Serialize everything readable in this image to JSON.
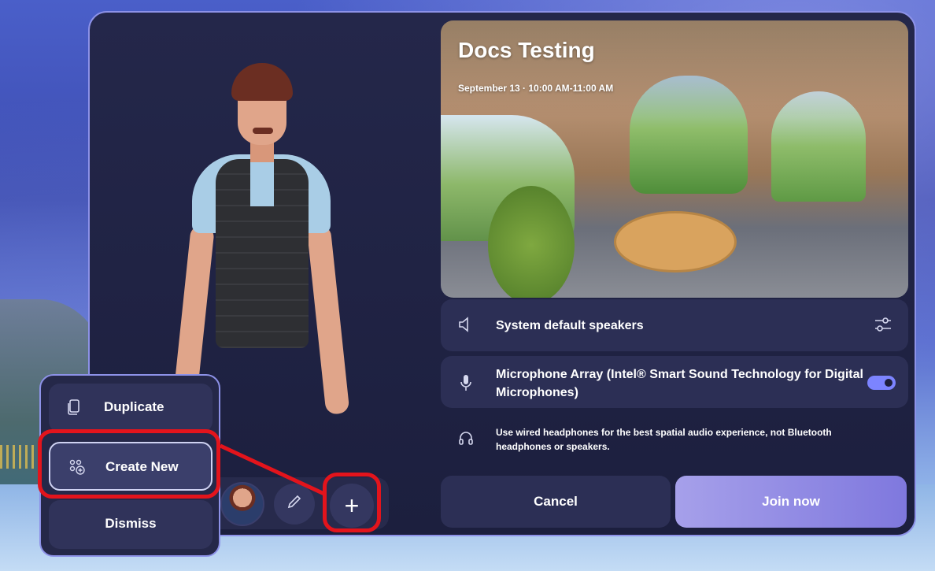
{
  "meeting": {
    "title": "Docs Testing",
    "time": "September 13 · 10:00 AM-11:00 AM"
  },
  "audio": {
    "speakers_label": "System default speakers",
    "microphone_label": "Microphone Array (Intel® Smart Sound Technology for Digital Microphones)",
    "microphone_enabled": true,
    "tip": "Use wired headphones for the best spatial audio experience, not Bluetooth headphones or speakers."
  },
  "actions": {
    "cancel": "Cancel",
    "join": "Join now"
  },
  "avatar_menu": {
    "duplicate": "Duplicate",
    "create_new": "Create New",
    "dismiss": "Dismiss"
  },
  "toolbar": {
    "plus_label": "+"
  },
  "colors": {
    "highlight": "#e3141c",
    "accent": "#7c84ff",
    "panel_border": "#8d92e8"
  }
}
